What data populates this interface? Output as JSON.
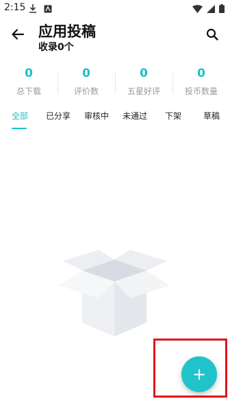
{
  "status_bar": {
    "time": "2:15",
    "icons": [
      "download-icon",
      "app-notification-icon",
      "wifi-icon",
      "signal-icon",
      "battery-icon"
    ]
  },
  "header": {
    "title": "应用投稿",
    "subtitle": "收录0个",
    "back_icon": "back-arrow-icon",
    "search_icon": "search-icon"
  },
  "stats": [
    {
      "value": "0",
      "label": "总下载"
    },
    {
      "value": "0",
      "label": "评价数"
    },
    {
      "value": "0",
      "label": "五星好评"
    },
    {
      "value": "0",
      "label": "投币数量"
    }
  ],
  "tabs": [
    {
      "label": "全部",
      "active": true
    },
    {
      "label": "已分享",
      "active": false
    },
    {
      "label": "审核中",
      "active": false
    },
    {
      "label": "未通过",
      "active": false
    },
    {
      "label": "下架",
      "active": false
    },
    {
      "label": "草稿",
      "active": false
    }
  ],
  "empty_state": {
    "icon": "empty-box-icon"
  },
  "fab": {
    "label": "+"
  },
  "colors": {
    "accent": "#19c2c8",
    "highlight": "#e0141a",
    "muted_text": "#9a9a9a"
  }
}
